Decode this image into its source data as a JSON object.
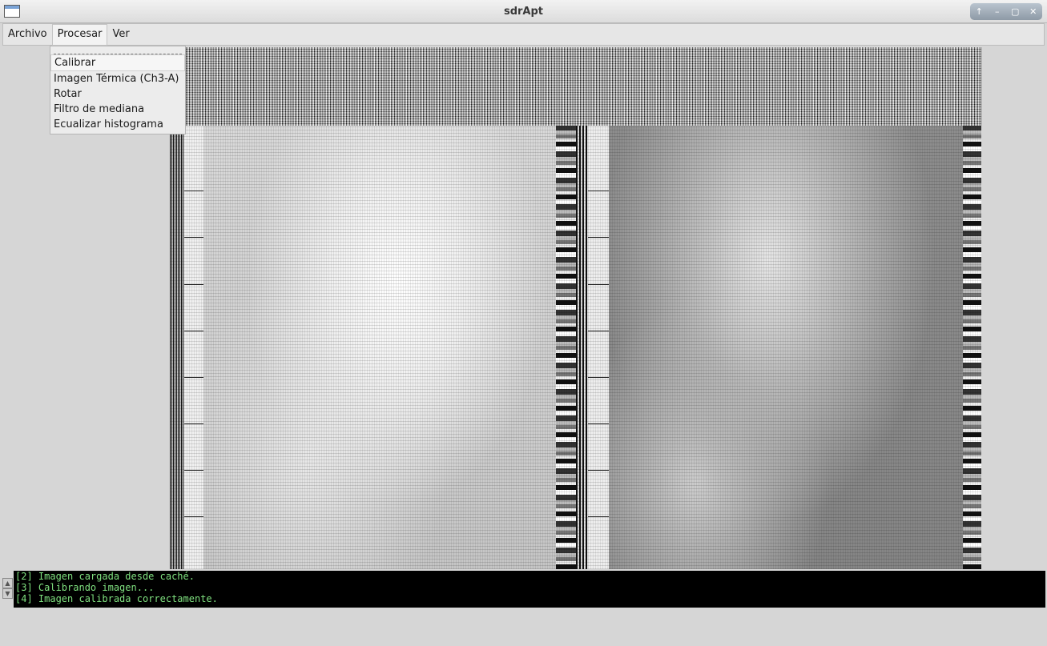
{
  "window": {
    "title": "sdrApt",
    "controls": [
      "↑",
      "–",
      "▢",
      "✕"
    ]
  },
  "menubar": {
    "items": [
      "Archivo",
      "Procesar",
      "Ver"
    ]
  },
  "dropdown": {
    "items": [
      "Calibrar",
      "Imagen Térmica (Ch3-A)",
      "Rotar",
      "Filtro de mediana",
      "Ecualizar histograma"
    ]
  },
  "console": {
    "lines": [
      "[2] Imagen cargada desde caché.",
      "[3] Calibrando imagen...",
      "[4] Imagen calibrada correctamente."
    ]
  },
  "colors": {
    "console_text": "#7fe07f",
    "console_bg": "#000000"
  }
}
